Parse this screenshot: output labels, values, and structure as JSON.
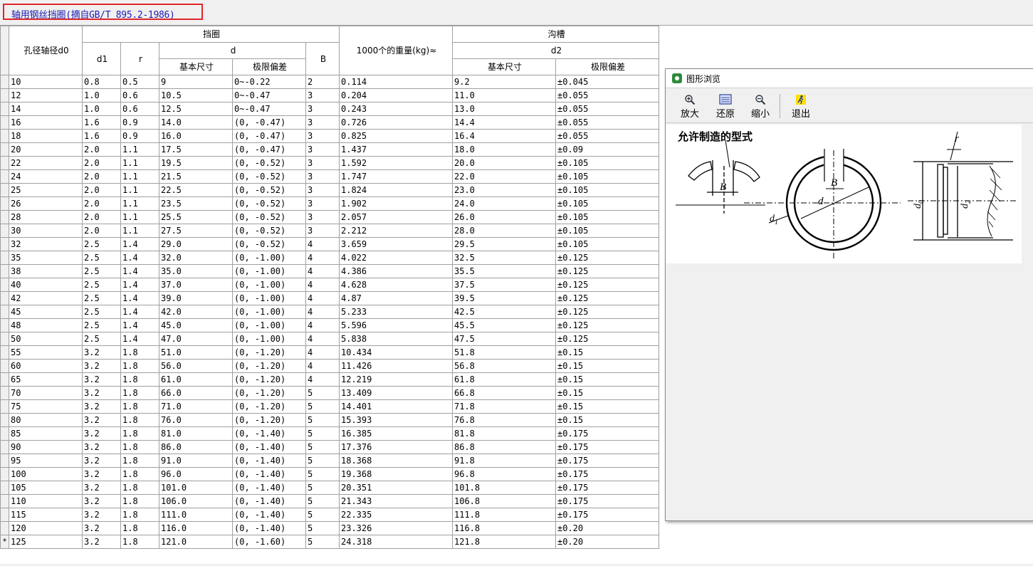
{
  "window": {
    "title": "轴用钢丝挡圈(摘自GB/T 895.2-1986)"
  },
  "table": {
    "headers": {
      "d0": "孔径轴径d0",
      "group_ring": "挡圈",
      "d1": "d1",
      "r": "r",
      "d": "d",
      "d_basic": "基本尺寸",
      "d_tol": "极限偏差",
      "B": "B",
      "weight": "1000个的重量(kg)≈",
      "group_groove": "沟槽",
      "d2": "d2",
      "d2_basic": "基本尺寸",
      "d2_tol": "极限偏差"
    },
    "new_row_marker": "*",
    "rows": [
      [
        "10",
        "0.8",
        "0.5",
        "9",
        "0~-0.22",
        "2",
        "0.114",
        "9.2",
        "±0.045"
      ],
      [
        "12",
        "1.0",
        "0.6",
        "10.5",
        "0~-0.47",
        "3",
        "0.204",
        "11.0",
        "±0.055"
      ],
      [
        "14",
        "1.0",
        "0.6",
        "12.5",
        "0~-0.47",
        "3",
        "0.243",
        "13.0",
        "±0.055"
      ],
      [
        "16",
        "1.6",
        "0.9",
        "14.0",
        "(0, -0.47)",
        "3",
        "0.726",
        "14.4",
        "±0.055"
      ],
      [
        "18",
        "1.6",
        "0.9",
        "16.0",
        "(0, -0.47)",
        "3",
        "0.825",
        "16.4",
        "±0.055"
      ],
      [
        "20",
        "2.0",
        "1.1",
        "17.5",
        "(0, -0.47)",
        "3",
        "1.437",
        "18.0",
        "±0.09"
      ],
      [
        "22",
        "2.0",
        "1.1",
        "19.5",
        "(0, -0.52)",
        "3",
        "1.592",
        "20.0",
        "±0.105"
      ],
      [
        "24",
        "2.0",
        "1.1",
        "21.5",
        "(0, -0.52)",
        "3",
        "1.747",
        "22.0",
        "±0.105"
      ],
      [
        "25",
        "2.0",
        "1.1",
        "22.5",
        "(0, -0.52)",
        "3",
        "1.824",
        "23.0",
        "±0.105"
      ],
      [
        "26",
        "2.0",
        "1.1",
        "23.5",
        "(0, -0.52)",
        "3",
        "1.902",
        "24.0",
        "±0.105"
      ],
      [
        "28",
        "2.0",
        "1.1",
        "25.5",
        "(0, -0.52)",
        "3",
        "2.057",
        "26.0",
        "±0.105"
      ],
      [
        "30",
        "2.0",
        "1.1",
        "27.5",
        "(0, -0.52)",
        "3",
        "2.212",
        "28.0",
        "±0.105"
      ],
      [
        "32",
        "2.5",
        "1.4",
        "29.0",
        "(0, -0.52)",
        "4",
        "3.659",
        "29.5",
        "±0.105"
      ],
      [
        "35",
        "2.5",
        "1.4",
        "32.0",
        "(0, -1.00)",
        "4",
        "4.022",
        "32.5",
        "±0.125"
      ],
      [
        "38",
        "2.5",
        "1.4",
        "35.0",
        "(0, -1.00)",
        "4",
        "4.386",
        "35.5",
        "±0.125"
      ],
      [
        "40",
        "2.5",
        "1.4",
        "37.0",
        "(0, -1.00)",
        "4",
        "4.628",
        "37.5",
        "±0.125"
      ],
      [
        "42",
        "2.5",
        "1.4",
        "39.0",
        "(0, -1.00)",
        "4",
        "4.87",
        "39.5",
        "±0.125"
      ],
      [
        "45",
        "2.5",
        "1.4",
        "42.0",
        "(0, -1.00)",
        "4",
        "5.233",
        "42.5",
        "±0.125"
      ],
      [
        "48",
        "2.5",
        "1.4",
        "45.0",
        "(0, -1.00)",
        "4",
        "5.596",
        "45.5",
        "±0.125"
      ],
      [
        "50",
        "2.5",
        "1.4",
        "47.0",
        "(0, -1.00)",
        "4",
        "5.838",
        "47.5",
        "±0.125"
      ],
      [
        "55",
        "3.2",
        "1.8",
        "51.0",
        "(0, -1.20)",
        "4",
        "10.434",
        "51.8",
        "±0.15"
      ],
      [
        "60",
        "3.2",
        "1.8",
        "56.0",
        "(0, -1.20)",
        "4",
        "11.426",
        "56.8",
        "±0.15"
      ],
      [
        "65",
        "3.2",
        "1.8",
        "61.0",
        "(0, -1.20)",
        "4",
        "12.219",
        "61.8",
        "±0.15"
      ],
      [
        "70",
        "3.2",
        "1.8",
        "66.0",
        "(0, -1.20)",
        "5",
        "13.409",
        "66.8",
        "±0.15"
      ],
      [
        "75",
        "3.2",
        "1.8",
        "71.0",
        "(0, -1.20)",
        "5",
        "14.401",
        "71.8",
        "±0.15"
      ],
      [
        "80",
        "3.2",
        "1.8",
        "76.0",
        "(0, -1.20)",
        "5",
        "15.393",
        "76.8",
        "±0.15"
      ],
      [
        "85",
        "3.2",
        "1.8",
        "81.0",
        "(0, -1.40)",
        "5",
        "16.385",
        "81.8",
        "±0.175"
      ],
      [
        "90",
        "3.2",
        "1.8",
        "86.0",
        "(0, -1.40)",
        "5",
        "17.376",
        "86.8",
        "±0.175"
      ],
      [
        "95",
        "3.2",
        "1.8",
        "91.0",
        "(0, -1.40)",
        "5",
        "18.368",
        "91.8",
        "±0.175"
      ],
      [
        "100",
        "3.2",
        "1.8",
        "96.0",
        "(0, -1.40)",
        "5",
        "19.368",
        "96.8",
        "±0.175"
      ],
      [
        "105",
        "3.2",
        "1.8",
        "101.0",
        "(0, -1.40)",
        "5",
        "20.351",
        "101.8",
        "±0.175"
      ],
      [
        "110",
        "3.2",
        "1.8",
        "106.0",
        "(0, -1.40)",
        "5",
        "21.343",
        "106.8",
        "±0.175"
      ],
      [
        "115",
        "3.2",
        "1.8",
        "111.0",
        "(0, -1.40)",
        "5",
        "22.335",
        "111.8",
        "±0.175"
      ],
      [
        "120",
        "3.2",
        "1.8",
        "116.0",
        "(0, -1.40)",
        "5",
        "23.326",
        "116.8",
        "±0.20"
      ],
      [
        "125",
        "3.2",
        "1.8",
        "121.0",
        "(0, -1.60)",
        "5",
        "24.318",
        "121.8",
        "±0.20"
      ]
    ]
  },
  "viewer": {
    "title": "图形浏览",
    "toolbar": {
      "zoom_in": "放大",
      "restore": "还原",
      "zoom_out": "缩小",
      "exit": "退出"
    },
    "figure": {
      "caption": "允许制造的型式",
      "label_B": "B",
      "label_B2": "B",
      "label_d": "d",
      "label_d1": "d",
      "label_d1_sub": "1",
      "label_r": "r",
      "label_d0": "d",
      "label_d0_sub": "0",
      "label_d2": "d",
      "label_d2_sub": "2"
    }
  }
}
